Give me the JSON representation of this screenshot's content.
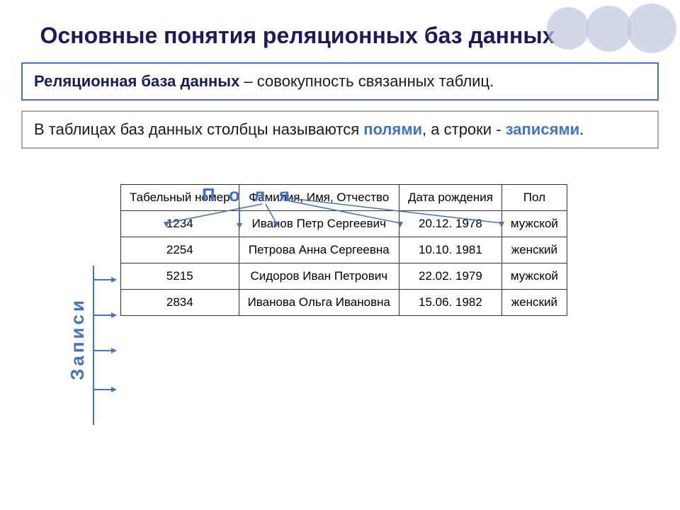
{
  "title": "Основные понятия реляционных баз данных",
  "definition": {
    "term": "Реляционная база данных",
    "dash": " – ",
    "rest": "совокупность связанных таблиц."
  },
  "info_text_1": "В таблицах баз данных столбцы называются ",
  "fields_word": "полями",
  "info_text_2": ", а строки - ",
  "records_word": "записями",
  "info_text_3": ".",
  "fields_label": "П о л я",
  "records_label": "Записи",
  "table": {
    "headers": [
      "Табельный номер",
      "Фамилия, Имя, Отчество",
      "Дата рождения",
      "Пол"
    ],
    "rows": [
      [
        "1234",
        "Иванов Петр Сергеевич",
        "20.12. 1978",
        "мужской"
      ],
      [
        "2254",
        "Петрова Анна Сергеевна",
        "10.10. 1981",
        "женский"
      ],
      [
        "5215",
        "Сидоров Иван Петрович",
        "22.02. 1979",
        "мужской"
      ],
      [
        "2834",
        "Иванова Ольга Ивановна",
        "15.06. 1982",
        "женский"
      ]
    ]
  }
}
